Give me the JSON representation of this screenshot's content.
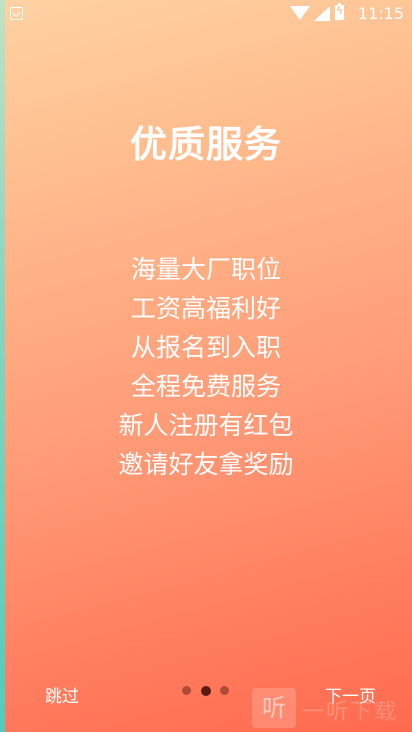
{
  "status_bar": {
    "time": "11:15",
    "icons": [
      "notification-icon",
      "wifi-icon",
      "signal-icon",
      "battery-charging-icon"
    ]
  },
  "page": {
    "title": "优质服务",
    "lines": [
      "海量大厂职位",
      "工资高福利好",
      "从报名到入职",
      "全程免费服务",
      "新人注册有红包",
      "邀请好友拿奖励"
    ]
  },
  "footer": {
    "skip_label": "跳过",
    "next_label": "下一页",
    "page_indicator": {
      "count": 3,
      "active_index": 1
    }
  },
  "watermark": {
    "glyph": "听",
    "text": "一听下载"
  },
  "colors": {
    "gradient_top": "#ffd2a3",
    "gradient_bottom": "#ff6a4e",
    "text": "#ffffff",
    "dot_active": "#5a1a10",
    "dot_inactive": "#b04a38"
  }
}
